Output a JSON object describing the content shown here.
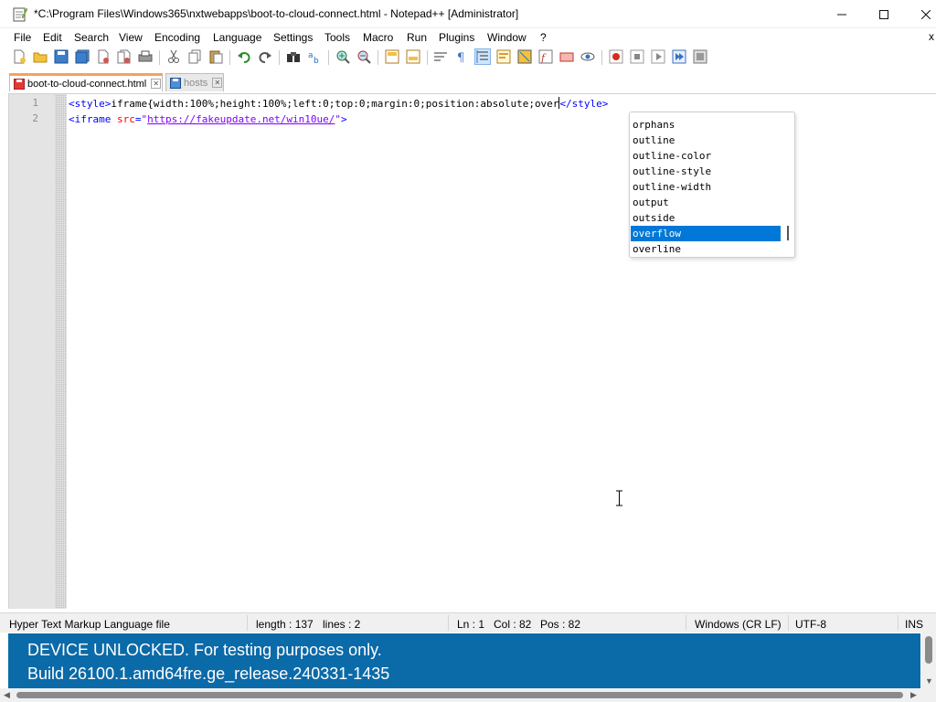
{
  "window": {
    "title": "*C:\\Program Files\\Windows365\\nxtwebapps\\boot-to-cloud-connect.html - Notepad++ [Administrator]"
  },
  "menu": [
    {
      "label": "File"
    },
    {
      "label": "Edit"
    },
    {
      "label": "Search"
    },
    {
      "label": "View"
    },
    {
      "label": "Encoding"
    },
    {
      "label": "Language"
    },
    {
      "label": "Settings"
    },
    {
      "label": "Tools"
    },
    {
      "label": "Macro"
    },
    {
      "label": "Run"
    },
    {
      "label": "Plugins"
    },
    {
      "label": "Window"
    },
    {
      "label": "?"
    }
  ],
  "menu_overflow": "x",
  "tabs": [
    {
      "label": "boot-to-cloud-connect.html"
    },
    {
      "label": "hosts"
    }
  ],
  "editor": {
    "line_numbers": [
      "1",
      "2"
    ],
    "line1": {
      "tag_open": "<style>",
      "text": "iframe{width:100%;height:100%;left:0;top:0;margin:0;position:absolute;over",
      "tag_close": "</style>"
    },
    "line2": {
      "tag_start": "<iframe",
      "attr": " src",
      "eq": "=",
      "quote_open": "\"",
      "url": "https://fakeupdate.net/win10ue/",
      "quote_close": "\"",
      "tag_end": ">"
    }
  },
  "autocomplete": {
    "items": [
      "orphans",
      "outline",
      "outline-color",
      "outline-style",
      "outline-width",
      "output",
      "outside",
      "overflow",
      "overline"
    ],
    "selected": "overflow"
  },
  "status": {
    "file_type": "Hyper Text Markup Language file",
    "length": "length : 137",
    "lines": "lines : 2",
    "ln": "Ln : 1",
    "col": "Col : 82",
    "pos": "Pos : 82",
    "eol": "Windows (CR LF)",
    "encoding": "UTF-8",
    "mode": "INS"
  },
  "banner": {
    "line1": "DEVICE UNLOCKED. For testing purposes only.",
    "line2": "Build 26100.1.amd64fre.ge_release.240331-1435"
  },
  "colors": {
    "accent_selection": "#0078d7",
    "banner_bg": "#0b6aa8",
    "tag": "#0000ff",
    "attribute": "#ff0000",
    "value": "#8000ff",
    "active_tab_marker": "#f6a15a"
  }
}
